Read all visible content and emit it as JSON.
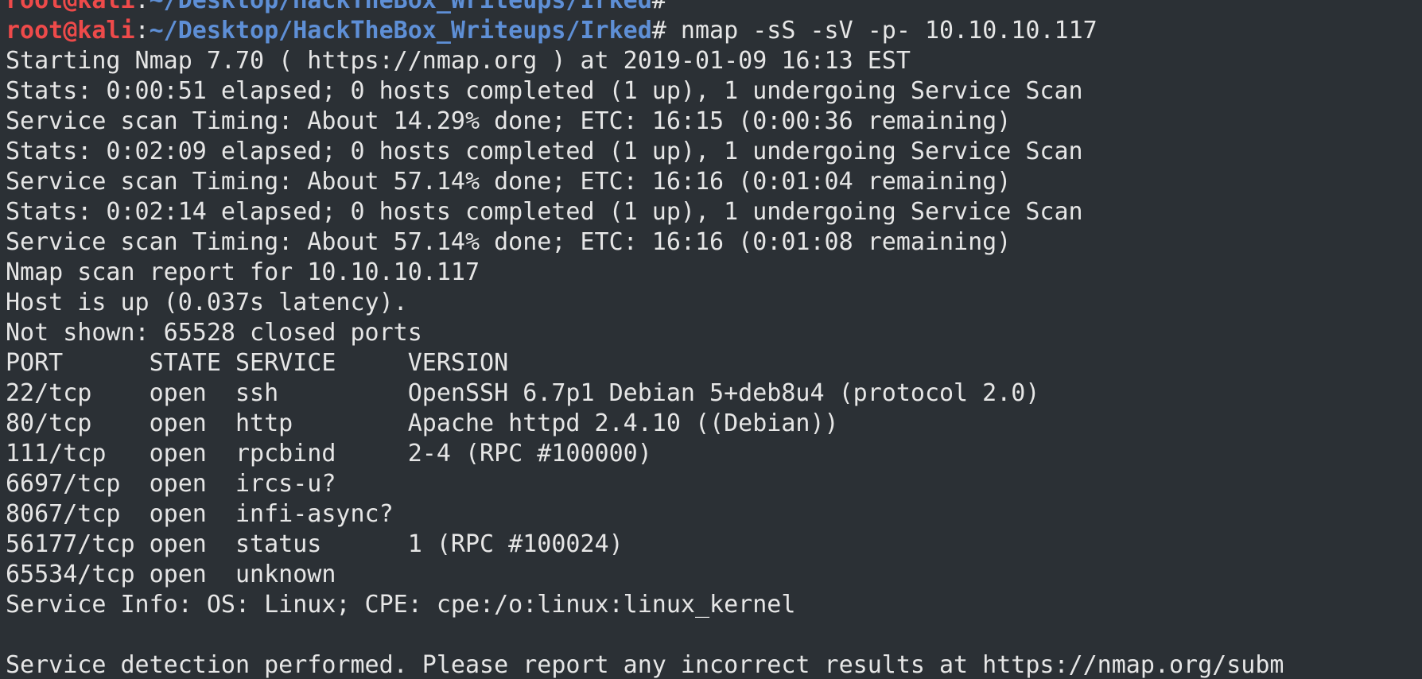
{
  "colors": {
    "background": "#2b3035",
    "text": "#e6e6e6",
    "prompt_user": "#ee4a4a",
    "prompt_path": "#5e8fd6"
  },
  "prompt": {
    "user_host": "root@kali",
    "separator": ":",
    "path": "~/Desktop/HackTheBox_Writeups/Irked",
    "symbol": "#"
  },
  "previous_prompt": {
    "command": ""
  },
  "current_prompt": {
    "command": " nmap -sS -sV -p- 10.10.10.117"
  },
  "output": [
    "Starting Nmap 7.70 ( https://nmap.org ) at 2019-01-09 16:13 EST",
    "Stats: 0:00:51 elapsed; 0 hosts completed (1 up), 1 undergoing Service Scan",
    "Service scan Timing: About 14.29% done; ETC: 16:15 (0:00:36 remaining)",
    "Stats: 0:02:09 elapsed; 0 hosts completed (1 up), 1 undergoing Service Scan",
    "Service scan Timing: About 57.14% done; ETC: 16:16 (0:01:04 remaining)",
    "Stats: 0:02:14 elapsed; 0 hosts completed (1 up), 1 undergoing Service Scan",
    "Service scan Timing: About 57.14% done; ETC: 16:16 (0:01:08 remaining)",
    "Nmap scan report for 10.10.10.117",
    "Host is up (0.037s latency).",
    "Not shown: 65528 closed ports",
    "PORT      STATE SERVICE     VERSION",
    "22/tcp    open  ssh         OpenSSH 6.7p1 Debian 5+deb8u4 (protocol 2.0)",
    "80/tcp    open  http        Apache httpd 2.4.10 ((Debian))",
    "111/tcp   open  rpcbind     2-4 (RPC #100000)",
    "6697/tcp  open  ircs-u?",
    "8067/tcp  open  infi-async?",
    "56177/tcp open  status      1 (RPC #100024)",
    "65534/tcp open  unknown",
    "Service Info: OS: Linux; CPE: cpe:/o:linux:linux_kernel",
    "",
    "Service detection performed. Please report any incorrect results at https://nmap.org/subm"
  ]
}
